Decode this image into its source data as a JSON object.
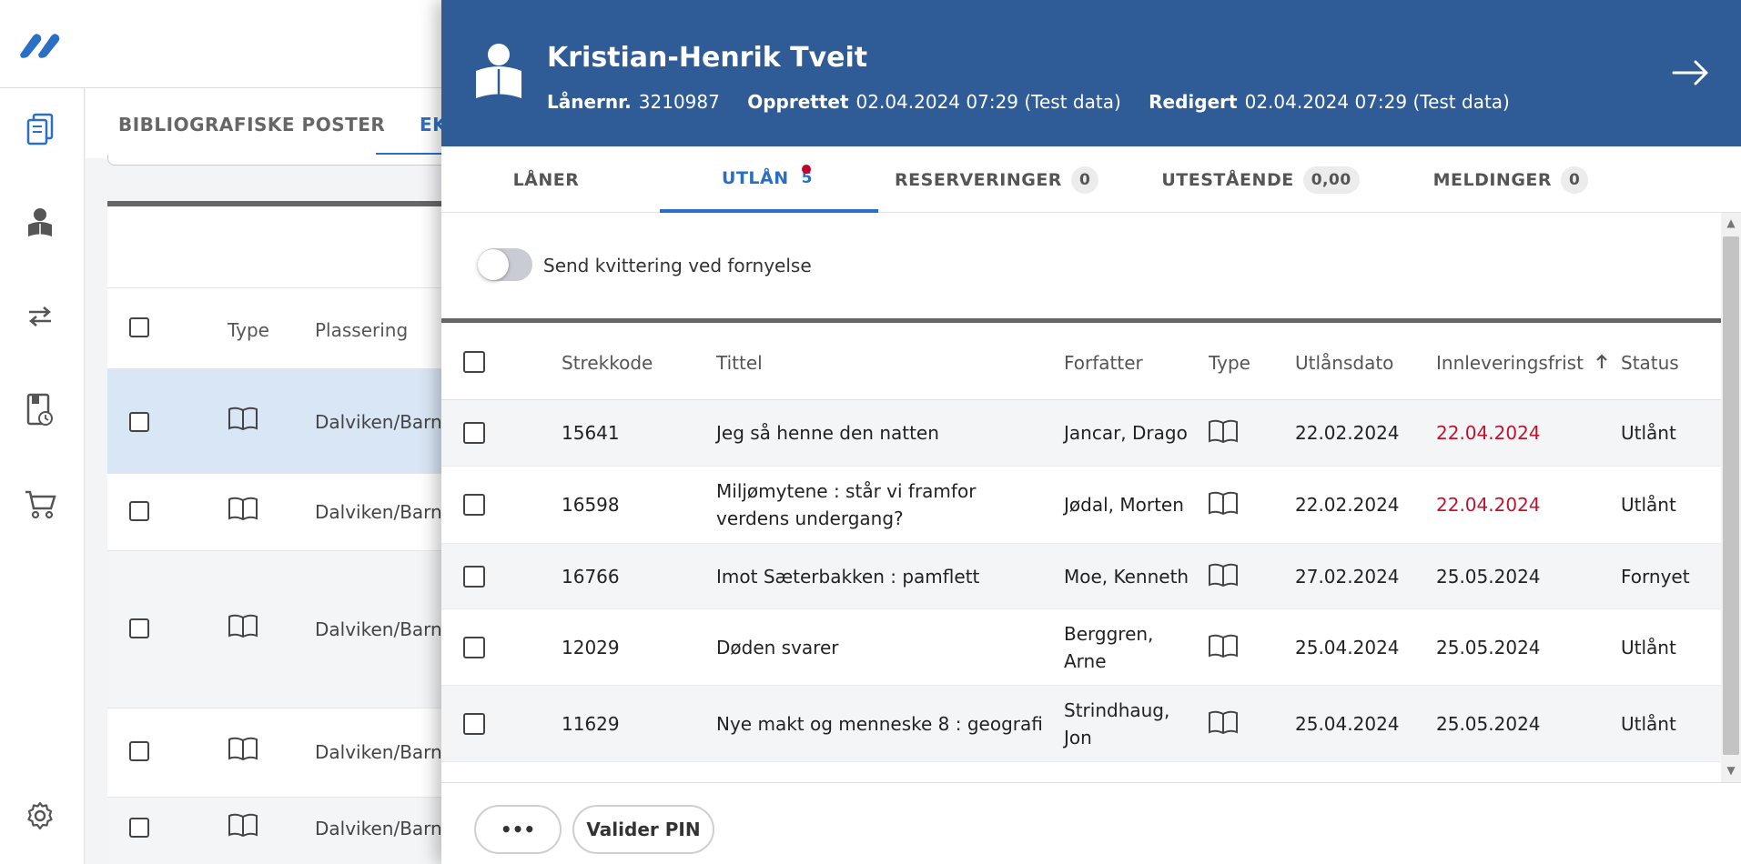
{
  "background": {
    "tabs": [
      {
        "label": "BIBLIOGRAFISKE POSTER"
      },
      {
        "label": "EK"
      }
    ],
    "columns": {
      "type": "Type",
      "location": "Plassering"
    },
    "rows": [
      {
        "location": "Dalviken/Barn"
      },
      {
        "location": "Dalviken/Barn"
      },
      {
        "location": "Dalviken/Barn"
      },
      {
        "location": "Dalviken/Barn"
      },
      {
        "location": "Dalviken/Barn"
      }
    ]
  },
  "rail": {
    "items": [
      {
        "icon": "catalog-icon"
      },
      {
        "icon": "patron-icon"
      },
      {
        "icon": "transfer-icon"
      },
      {
        "icon": "loan-history-icon"
      },
      {
        "icon": "cart-icon"
      },
      {
        "icon": "gear-icon"
      }
    ]
  },
  "patron": {
    "name": "Kristian-Henrik Tveit",
    "card_label": "Lånernr.",
    "card_number": "3210987",
    "created_label": "Opprettet",
    "created_value": "02.04.2024 07:29 (Test data)",
    "edited_label": "Redigert",
    "edited_value": "02.04.2024 07:29 (Test data)"
  },
  "tabs": [
    {
      "label": "LÅNER",
      "count": ""
    },
    {
      "label": "UTLÅN",
      "count": "5"
    },
    {
      "label": "RESERVERINGER",
      "count": "0"
    },
    {
      "label": "UTESTÅENDE",
      "count": "0,00"
    },
    {
      "label": "MELDINGER",
      "count": "0"
    }
  ],
  "toggle": {
    "label": "Send kvittering ved fornyelse",
    "on": false
  },
  "table": {
    "headers": {
      "barcode": "Strekkode",
      "title": "Tittel",
      "author": "Forfatter",
      "type": "Type",
      "loan_date": "Utlånsdato",
      "due_date": "Innleveringsfrist",
      "status": "Status"
    },
    "rows": [
      {
        "barcode": "15641",
        "title": "Jeg så henne den natten",
        "author": "Jancar, Drago",
        "loan_date": "22.02.2024",
        "due_date": "22.04.2024",
        "overdue": true,
        "status": "Utlånt"
      },
      {
        "barcode": "16598",
        "title": "Miljømytene : står vi framfor verdens undergang?",
        "author": "Jødal, Morten",
        "loan_date": "22.02.2024",
        "due_date": "22.04.2024",
        "overdue": true,
        "status": "Utlånt"
      },
      {
        "barcode": "16766",
        "title": "Imot Sæterbakken : pamflett",
        "author": "Moe, Kenneth",
        "loan_date": "27.02.2024",
        "due_date": "25.05.2024",
        "overdue": false,
        "status": "Fornyet"
      },
      {
        "barcode": "12029",
        "title": "Døden svarer",
        "author": "Berggren, Arne",
        "loan_date": "25.04.2024",
        "due_date": "25.05.2024",
        "overdue": false,
        "status": "Utlånt"
      },
      {
        "barcode": "11629",
        "title": "Nye makt og menneske 8 : geografi",
        "author": "Strindhaug, Jon",
        "loan_date": "25.04.2024",
        "due_date": "25.05.2024",
        "overdue": false,
        "status": "Utlånt"
      }
    ]
  },
  "footer": {
    "more_label": "•••",
    "validate_label": "Valider PIN"
  },
  "colors": {
    "header_bg": "#2f5c97",
    "accent": "#2a6fc4",
    "overdue": "#c0142e",
    "notification_dot": "#c6002b"
  }
}
